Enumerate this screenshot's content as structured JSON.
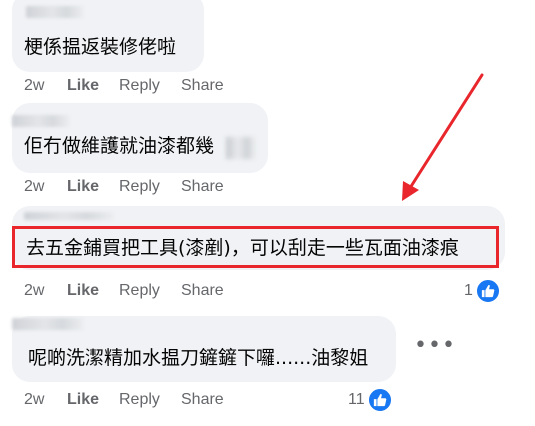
{
  "comments": [
    {
      "text": "梗係揾返裝修佬啦",
      "actions": {
        "time": "2w",
        "like": "Like",
        "reply": "Reply",
        "share": "Share"
      }
    },
    {
      "text": "佢冇做維護就油漆都幾",
      "actions": {
        "time": "2w",
        "like": "Like",
        "reply": "Reply",
        "share": "Share"
      }
    },
    {
      "text": "去五金鋪買把工具(漆剷)，可以刮走一些瓦面油漆痕",
      "actions": {
        "time": "2w",
        "like": "Like",
        "reply": "Reply",
        "share": "Share"
      },
      "reactions": {
        "count": "1",
        "icon": "like-thumb-icon"
      }
    },
    {
      "text": "呢啲洗潔精加水揾刀鏟鏟下囉......油黎姐",
      "actions": {
        "time": "2w",
        "like": "Like",
        "reply": "Reply",
        "share": "Share"
      },
      "reactions": {
        "count": "11",
        "icon": "like-thumb-icon"
      }
    }
  ],
  "annotation": {
    "color": "#e8262b"
  },
  "colors": {
    "bubble": "#f0f2f5",
    "action_text": "#65676b",
    "like_blue": "#1877f2"
  }
}
